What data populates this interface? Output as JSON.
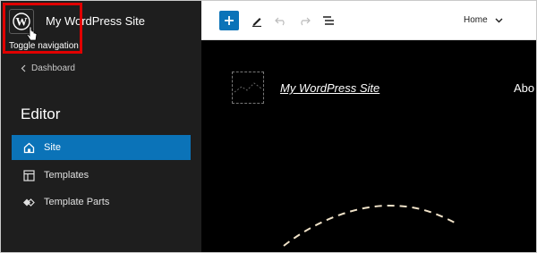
{
  "sidebar": {
    "site_title": "My WordPress Site",
    "tooltip": "Toggle navigation",
    "back_label": "Dashboard",
    "heading": "Editor",
    "items": [
      {
        "label": "Site",
        "icon": "home-icon",
        "active": true
      },
      {
        "label": "Templates",
        "icon": "layout-icon",
        "active": false
      },
      {
        "label": "Template Parts",
        "icon": "symbol-icon",
        "active": false
      }
    ]
  },
  "toolbar": {
    "template_menu": "Home"
  },
  "canvas": {
    "site_title": "My WordPress Site",
    "nav_partial": "Abo"
  },
  "colors": {
    "accent": "#0b73b8",
    "highlight": "#e00000",
    "sidebar_bg": "#1e1e1e",
    "canvas_bg": "#000000"
  }
}
